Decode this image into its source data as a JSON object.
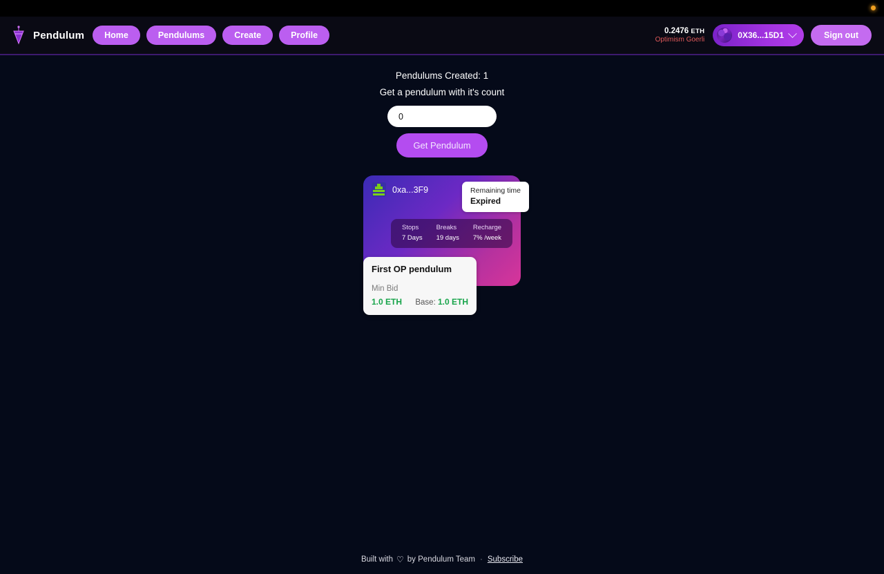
{
  "topbar": {
    "notification_dot_color": "#f0a020"
  },
  "header": {
    "brand": "Pendulum",
    "logo_icon": "pendulum-icon",
    "nav": [
      {
        "label": "Home"
      },
      {
        "label": "Pendulums"
      },
      {
        "label": "Create"
      },
      {
        "label": "Profile"
      }
    ],
    "wallet": {
      "balance": "0.2476",
      "balance_unit": "ETH",
      "network": "Optimism Goerli",
      "network_color": "#e05a5a",
      "address": "0X36...15D1",
      "avatar_icon": "wallet-avatar-icon",
      "chevron_icon": "chevron-down-icon"
    },
    "signout_label": "Sign out",
    "accent_color": "#bb5ef0"
  },
  "main": {
    "created_count_text": "Pendulums Created: 1",
    "subtitle": "Get a pendulum with it's count",
    "count_input_value": "0",
    "count_input_placeholder": "0",
    "get_button_label": "Get Pendulum"
  },
  "pendulum_card": {
    "owner_address": "0xa...3F9",
    "owner_icon": "owner-blockie-icon",
    "remaining_label": "Remaining time",
    "remaining_value": "Expired",
    "stats": [
      {
        "label": "Stops",
        "value": "7 Days"
      },
      {
        "label": "Breaks",
        "value": "19 days"
      },
      {
        "label": "Recharge",
        "value": "7% /week"
      }
    ],
    "title": "First OP pendulum",
    "min_bid_label": "Min Bid",
    "min_bid_value": "1.0 ETH",
    "base_label": "Base:",
    "base_value": "1.0 ETH",
    "bid_color": "#17a44a",
    "gradient_start": "#3b2bb5",
    "gradient_end": "#d8359a"
  },
  "footer": {
    "built_with": "Built with",
    "heart_icon": "heart-icon",
    "by_team": "by Pendulum Team",
    "separator": "·",
    "subscribe_label": "Subscribe"
  }
}
